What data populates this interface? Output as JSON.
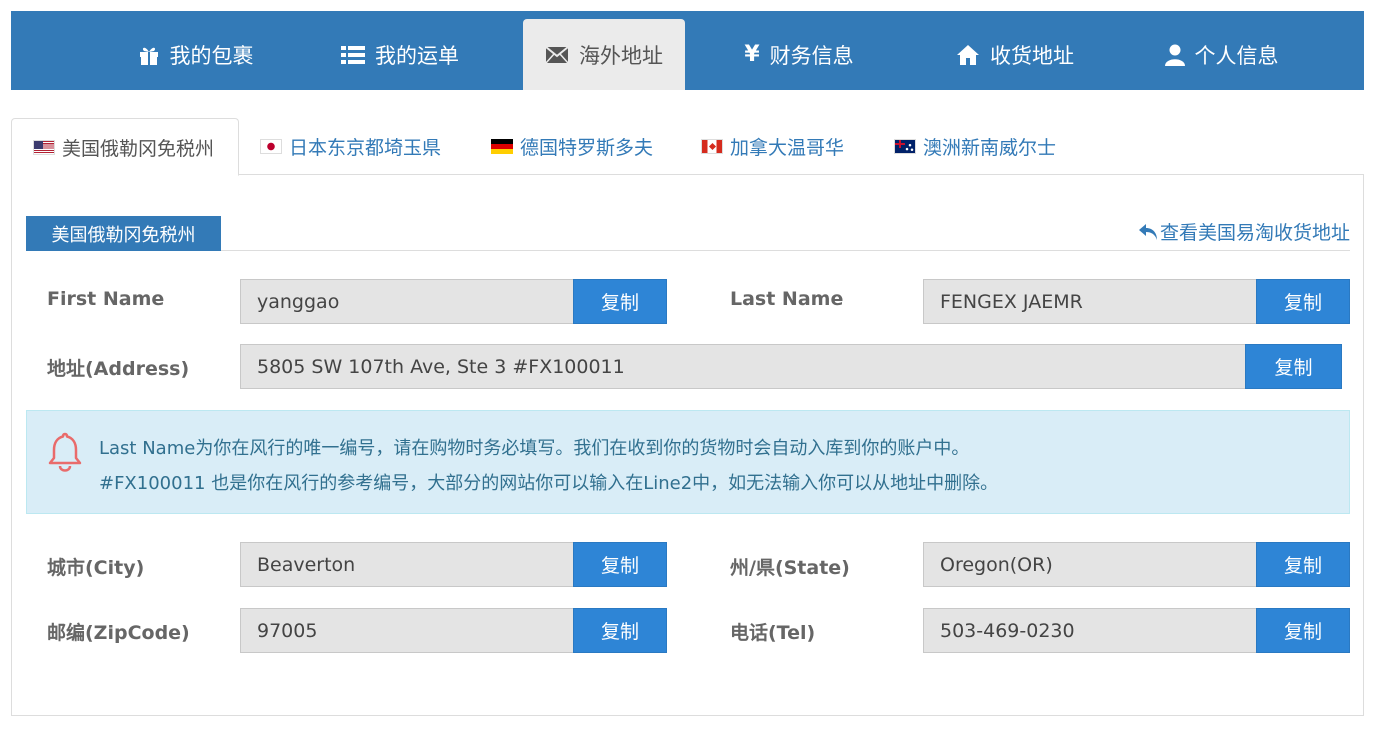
{
  "nav": {
    "items": [
      {
        "label": "我的包裹",
        "icon": "gift-icon"
      },
      {
        "label": "我的运单",
        "icon": "list-icon"
      },
      {
        "label": "海外地址",
        "icon": "envelope-icon",
        "active": true
      },
      {
        "label": "财务信息",
        "icon": "yen-icon"
      },
      {
        "label": "收货地址",
        "icon": "home-icon"
      },
      {
        "label": "个人信息",
        "icon": "user-icon"
      }
    ]
  },
  "tabs": [
    {
      "label": "美国俄勒冈免税州",
      "flag": "us-flag-icon",
      "active": true
    },
    {
      "label": "日本东京都埼玉県",
      "flag": "jp-flag-icon"
    },
    {
      "label": "德国特罗斯多夫",
      "flag": "de-flag-icon"
    },
    {
      "label": "加拿大温哥华",
      "flag": "ca-flag-icon"
    },
    {
      "label": "澳洲新南威尔士",
      "flag": "au-flag-icon"
    }
  ],
  "section": {
    "title": "美国俄勒冈免税州",
    "link": "查看美国易淘收货地址"
  },
  "form": {
    "copy_label": "复制",
    "first_name": {
      "label": "First Name",
      "value": "yanggao"
    },
    "last_name": {
      "label": "Last Name",
      "value": "FENGEX JAEMR"
    },
    "address": {
      "label": "地址(Address)",
      "value": "5805 SW 107th Ave, Ste 3 #FX100011"
    },
    "city": {
      "label": "城市(City)",
      "value": "Beaverton"
    },
    "state": {
      "label": "州/県(State)",
      "value": "Oregon(OR)"
    },
    "zip": {
      "label": "邮编(ZipCode)",
      "value": "97005"
    },
    "tel": {
      "label": "电话(Tel)",
      "value": "503-469-0230"
    }
  },
  "alert": {
    "line1": "Last Name为你在风行的唯一编号，请在购物时务必填写。我们在收到你的货物时会自动入库到你的账户中。",
    "line2": "#FX100011 也是你在风行的参考编号，大部分的网站你可以输入在Line2中，如无法输入你可以从地址中删除。"
  },
  "colors": {
    "nav_bg": "#337ab7",
    "accent_button": "#2e85d6",
    "alert_bg": "#d9edf7",
    "alert_text": "#31708f"
  }
}
